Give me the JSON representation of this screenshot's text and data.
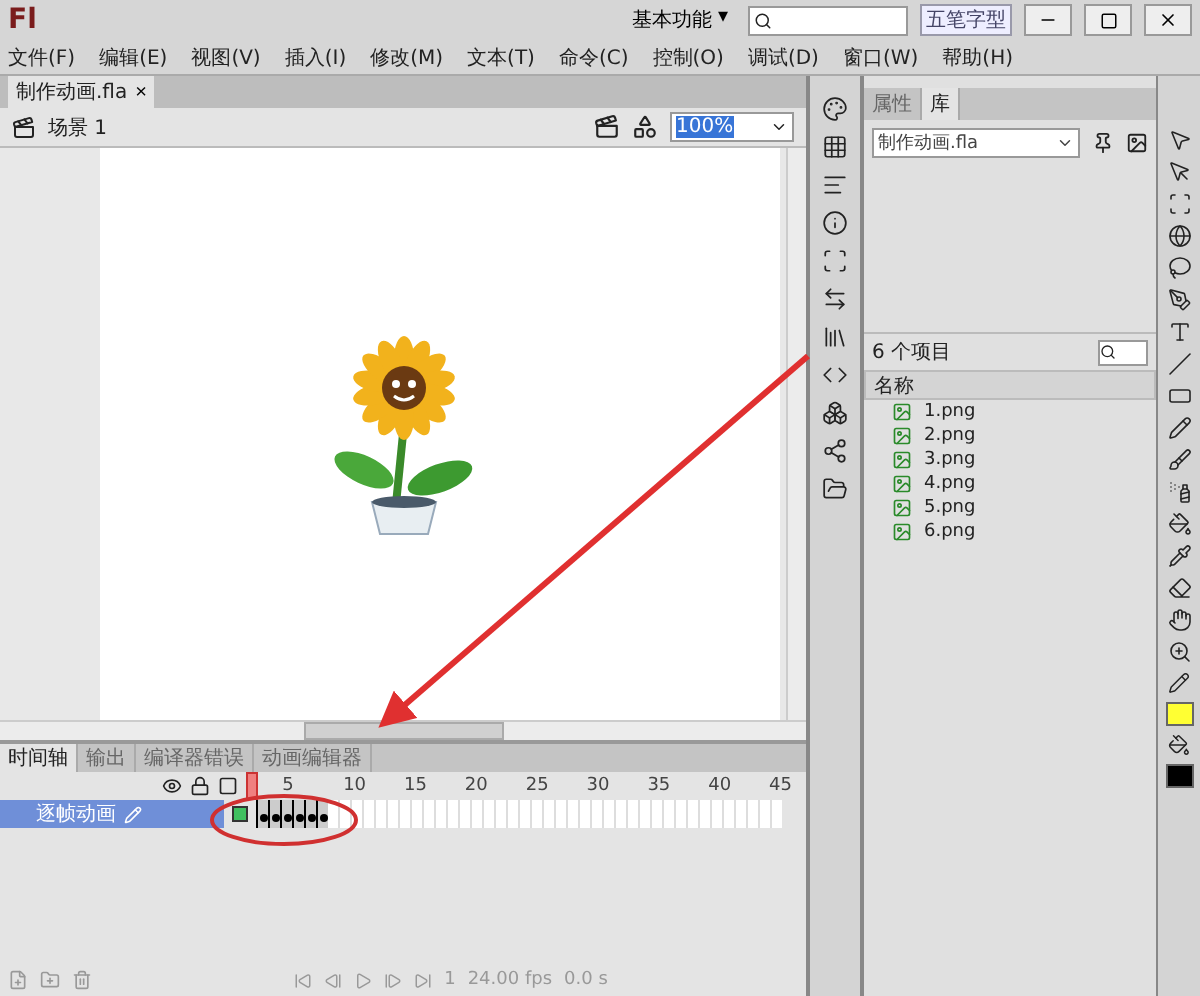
{
  "app": {
    "logo": "Fl",
    "workspace": "基本功能",
    "workspace_caret": "▾",
    "ime": "五笔字型"
  },
  "menu": [
    "文件(F)",
    "编辑(E)",
    "视图(V)",
    "插入(I)",
    "修改(M)",
    "文本(T)",
    "命令(C)",
    "控制(O)",
    "调试(D)",
    "窗口(W)",
    "帮助(H)"
  ],
  "document_tab": {
    "title": "制作动画.fla",
    "close": "×"
  },
  "scene": {
    "name": "场景 1",
    "zoom": "100%"
  },
  "library": {
    "tabs": [
      {
        "label": "属性",
        "selected": false
      },
      {
        "label": "库",
        "selected": true
      }
    ],
    "file": "制作动画.fla",
    "count": "6 个项目",
    "column": "名称",
    "items": [
      "1.png",
      "2.png",
      "3.png",
      "4.png",
      "5.png",
      "6.png"
    ]
  },
  "timeline": {
    "tabs": [
      {
        "label": "时间轴",
        "selected": true
      },
      {
        "label": "输出",
        "selected": false
      },
      {
        "label": "编译器错误",
        "selected": false
      },
      {
        "label": "动画编辑器",
        "selected": false
      }
    ],
    "ruler": [
      "5",
      "10",
      "15",
      "20",
      "25",
      "30",
      "35",
      "40",
      "45"
    ],
    "layers": [
      {
        "name": "逐帧动画",
        "selected": true,
        "frames": [
          {
            "kind": "keyframe"
          },
          {
            "kind": "keyframe"
          },
          {
            "kind": "keyframe"
          },
          {
            "kind": "keyframe"
          },
          {
            "kind": "keyframe"
          },
          {
            "kind": "keyframe"
          }
        ]
      }
    ],
    "status": {
      "frame": "1",
      "fps": "24.00 fps",
      "time": "0.0 s"
    }
  }
}
